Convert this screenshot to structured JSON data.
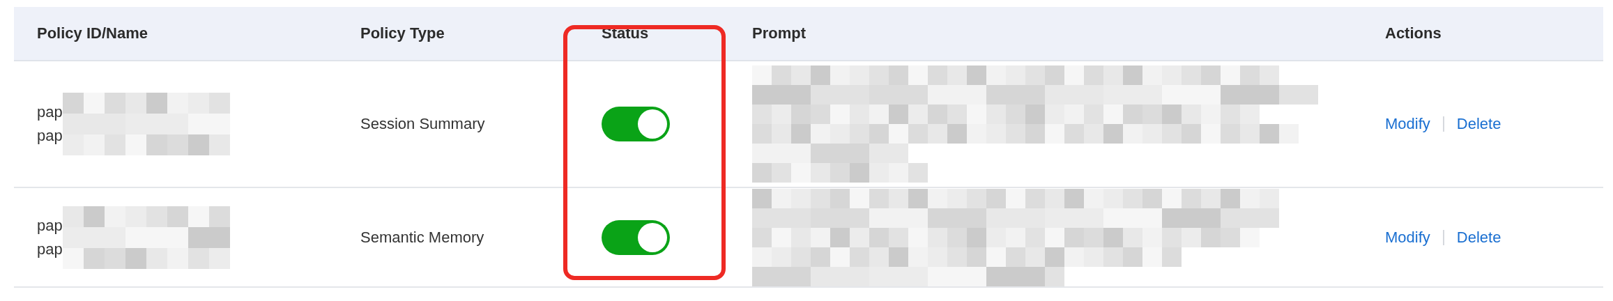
{
  "table": {
    "columns": [
      "Policy ID/Name",
      "Policy Type",
      "Status",
      "Prompt",
      "Actions"
    ],
    "rows": [
      {
        "name_lines": [
          "pap",
          "pap"
        ],
        "type": "Session Summary",
        "status_on": true,
        "actions": [
          "Modify",
          "Delete"
        ]
      },
      {
        "name_lines": [
          "pap",
          "pap"
        ],
        "type": "Semantic Memory",
        "status_on": true,
        "actions": [
          "Modify",
          "Delete"
        ]
      }
    ]
  },
  "status_column_highlighted": true
}
